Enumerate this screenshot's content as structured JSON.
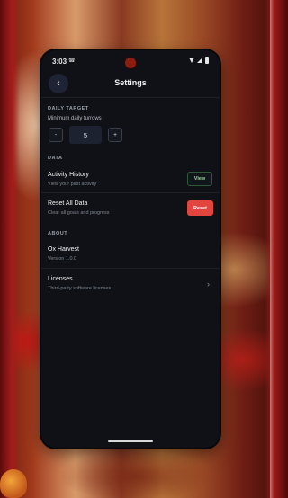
{
  "status_bar": {
    "time": "3:03",
    "sim": "☎",
    "icons": [
      "wifi-icon",
      "signal-icon",
      "battery-icon"
    ]
  },
  "header": {
    "back_icon": "‹",
    "title": "Settings"
  },
  "daily_target": {
    "section": "DAILY TARGET",
    "label": "Minimum daily furrows",
    "decrement": "-",
    "value": "5",
    "increment": "+"
  },
  "data_section": {
    "section": "DATA",
    "activity": {
      "title": "Activity History",
      "description": "View your past activity",
      "button": "View"
    },
    "reset": {
      "title": "Reset All Data",
      "description": "Clear all goals and progress",
      "button": "Reset"
    }
  },
  "about": {
    "section": "ABOUT",
    "app_name": "Ox Harvest",
    "version": "Version 1.0.0",
    "licenses_title": "Licenses",
    "licenses_desc": "Third-party software licenses",
    "chevron": "›"
  },
  "colors": {
    "background": "#0f1116",
    "accent_reset": "#e2453e",
    "accent_view": "#9fd0a4"
  }
}
